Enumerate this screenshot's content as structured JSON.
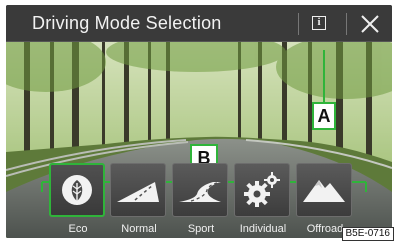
{
  "header": {
    "title": "Driving Mode Selection"
  },
  "callouts": {
    "a": "A",
    "b": "B"
  },
  "modes": [
    {
      "label": "Eco",
      "icon": "leaf-icon",
      "selected": true
    },
    {
      "label": "Normal",
      "icon": "road-icon",
      "selected": false
    },
    {
      "label": "Sport",
      "icon": "curved-road-icon",
      "selected": false
    },
    {
      "label": "Individual",
      "icon": "gears-icon",
      "selected": false
    },
    {
      "label": "Offroad",
      "icon": "mountain-icon",
      "selected": false
    }
  ],
  "figure_ref": "B5E-0716",
  "colors": {
    "accent": "#2fb43a",
    "titlebar": "#3a3a3a",
    "text": "#f2f2f2"
  }
}
